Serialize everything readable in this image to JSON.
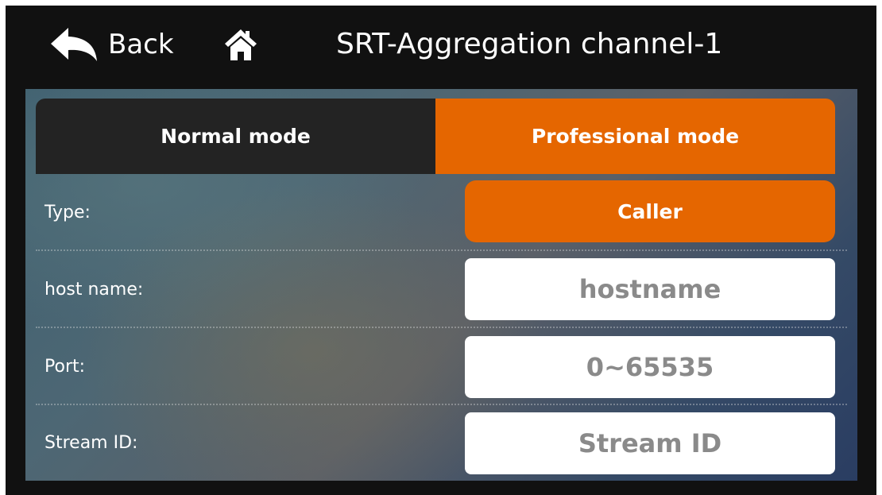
{
  "doc_fragment": "g",
  "header": {
    "back_label": "Back",
    "title": "SRT-Aggregation channel-1"
  },
  "tabs": [
    {
      "label": "Normal mode",
      "active": false
    },
    {
      "label": "Professional mode",
      "active": true
    }
  ],
  "form": {
    "type_label": "Type:",
    "type_value": "Caller",
    "host_label": "host name:",
    "host_placeholder": "hostname",
    "port_label": "Port:",
    "port_placeholder": "0~65535",
    "stream_label": "Stream ID:",
    "stream_placeholder": "Stream ID"
  },
  "colors": {
    "accent": "#e56600",
    "header_bg": "#111111",
    "inactive_tab": "#232323"
  },
  "icons": {
    "back": "back-arrow-icon",
    "home": "home-icon"
  }
}
